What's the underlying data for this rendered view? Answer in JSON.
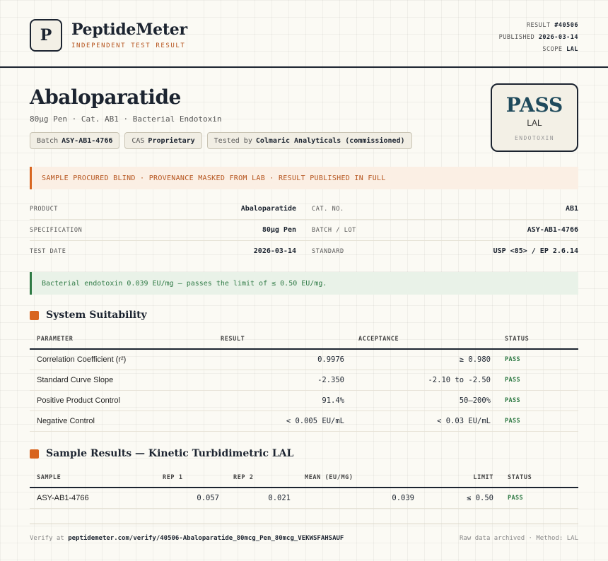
{
  "brand": {
    "logo_letter": "P",
    "name": "PeptideMeter",
    "tagline": "INDEPENDENT TEST RESULT"
  },
  "meta": {
    "result_label": "RESULT",
    "result_value": "#40506",
    "published_label": "PUBLISHED",
    "published_value": "2026-03-14",
    "scope_label": "SCOPE",
    "scope_value": "LAL"
  },
  "product": {
    "title": "Abaloparatide",
    "subtitle": "80µg Pen · Cat. AB1 · Bacterial Endotoxin",
    "chips": [
      {
        "label": "Batch",
        "value": "ASY-AB1-4766"
      },
      {
        "label": "CAS",
        "value": "Proprietary"
      },
      {
        "label": "Tested by",
        "value": "Colmaric Analyticals (commissioned)"
      }
    ]
  },
  "verdict": {
    "word": "PASS",
    "test": "LAL",
    "category": "ENDOTOXIN"
  },
  "banner": "SAMPLE PROCURED BLIND · PROVENANCE MASKED FROM LAB · RESULT PUBLISHED IN FULL",
  "info": [
    {
      "l1": "PRODUCT",
      "v1": "Abaloparatide",
      "l2": "CAT. NO.",
      "v2": "AB1"
    },
    {
      "l1": "SPECIFICATION",
      "v1": "80µg Pen",
      "l2": "BATCH / LOT",
      "v2": "ASY-AB1-4766"
    },
    {
      "l1": "TEST DATE",
      "v1": "2026-03-14",
      "l2": "STANDARD",
      "v2": "USP <85> / EP 2.6.14"
    }
  ],
  "result_note": "Bacterial endotoxin 0.039 EU/mg — passes the limit of ≤ 0.50 EU/mg.",
  "suitability": {
    "title": "System Suitability",
    "headers": [
      "PARAMETER",
      "RESULT",
      "ACCEPTANCE",
      "STATUS"
    ],
    "rows": [
      {
        "parameter": "Correlation Coefficient (r²)",
        "result": "0.9976",
        "acceptance": "≥ 0.980",
        "status": "PASS"
      },
      {
        "parameter": "Standard Curve Slope",
        "result": "-2.350",
        "acceptance": "-2.10 to -2.50",
        "status": "PASS"
      },
      {
        "parameter": "Positive Product Control",
        "result": "91.4%",
        "acceptance": "50–200%",
        "status": "PASS"
      },
      {
        "parameter": "Negative Control",
        "result": "< 0.005 EU/mL",
        "acceptance": "< 0.03 EU/mL",
        "status": "PASS"
      }
    ]
  },
  "samples": {
    "title": "Sample Results — Kinetic Turbidimetric LAL",
    "headers": [
      "SAMPLE",
      "REP 1",
      "REP 2",
      "MEAN (EU/MG)",
      "LIMIT",
      "STATUS"
    ],
    "rows": [
      {
        "sample": "ASY-AB1-4766",
        "rep1": "0.057",
        "rep2": "0.021",
        "mean": "0.039",
        "limit": "≤ 0.50",
        "status": "PASS"
      }
    ]
  },
  "footer": {
    "verify_label": "Verify at",
    "verify_url": "peptidemeter.com/verify/40506-Abaloparatide_80mcg_Pen_80mcg_VEKWSFAHSAUF",
    "right_text": "Raw data archived · Method: LAL"
  },
  "colors": {
    "accent": "#d8651f",
    "pass_green": "#2f7a45",
    "pass_word": "#1f4a5c",
    "ink": "#1c2430"
  }
}
